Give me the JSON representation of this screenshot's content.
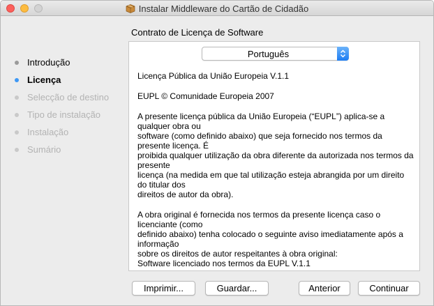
{
  "window": {
    "title": "Instalar Middleware do Cartão de Cidadão"
  },
  "pane_heading": "Contrato de Licença de Software",
  "steps": [
    {
      "label": "Introdução",
      "state": "done"
    },
    {
      "label": "Licença",
      "state": "current"
    },
    {
      "label": "Selecção de destino",
      "state": "pending"
    },
    {
      "label": "Tipo de instalação",
      "state": "pending"
    },
    {
      "label": "Instalação",
      "state": "pending"
    },
    {
      "label": "Sumário",
      "state": "pending"
    }
  ],
  "language_select": {
    "value": "Português",
    "icon": "up-down-chevrons-icon"
  },
  "license": {
    "paragraphs": [
      "Licença Pública da União Europeia V.1.1",
      "EUPL © Comunidade Europeia 2007",
      "A presente licença pública da União Europeia (“EUPL”) aplica-se a qualquer obra ou\nsoftware (como definido abaixo) que seja fornecido nos termos da presente licença. É\nproibida qualquer utilização da obra diferente da autorizada nos termos da presente\nlicença (na medida em que tal utilização esteja abrangida por um direito do titular dos\ndireitos de autor da obra).",
      "A obra original é fornecida nos termos da presente licença caso o licenciante (como\ndefinido abaixo) tenha colocado o seguinte aviso imediatamente após a informação\nsobre os direitos de autor respeitantes à obra original:\nSoftware licenciado nos termos da EUPL V.1.1"
    ]
  },
  "buttons": {
    "print": "Imprimir...",
    "save": "Guardar...",
    "back": "Anterior",
    "continue": "Continuar"
  },
  "colors": {
    "accent": "#3e98f5",
    "window_bg": "#ececec",
    "close": "#fc605c",
    "minimize": "#fdbc40"
  }
}
